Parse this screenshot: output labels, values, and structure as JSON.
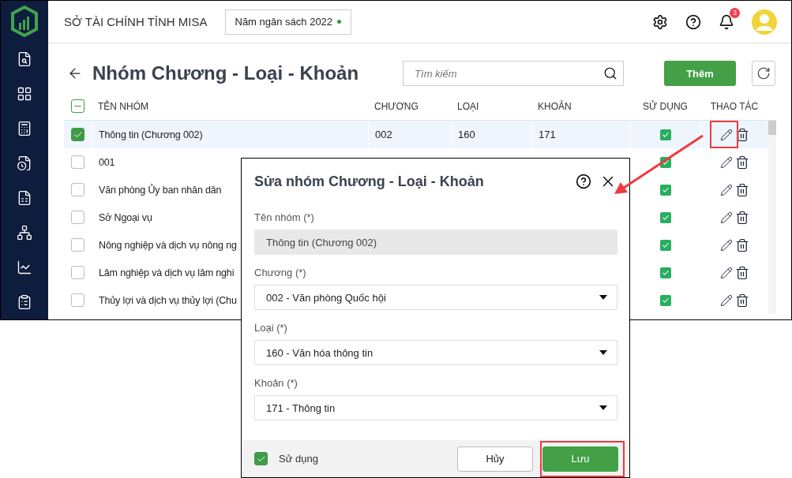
{
  "header": {
    "organization": "SỞ TÀI CHÍNH TỈNH MISA",
    "budget_year": "Năm ngân sách 2022",
    "notification_count": "3"
  },
  "page": {
    "title": "Nhóm Chương - Loại - Khoản",
    "search": {
      "placeholder": "Tìm kiếm"
    },
    "add_button": "Thêm"
  },
  "table": {
    "select_all": {
      "indeterminate": true
    },
    "columns": [
      "TÊN NHÓM",
      "CHƯƠNG",
      "LOẠI",
      "KHOẢN",
      "SỬ DỤNG",
      "THAO TÁC"
    ],
    "rows": [
      {
        "name": "Thông tin (Chương 002)",
        "chuong": "002",
        "loai": "160",
        "khoan": "171",
        "checked": true,
        "selected": true,
        "used": true
      },
      {
        "name": "001",
        "checked": false,
        "selected": false,
        "used": true
      },
      {
        "name": "Văn phòng Ủy ban nhân dân",
        "checked": false,
        "selected": false,
        "used": true
      },
      {
        "name": "Sở Ngoại vụ",
        "checked": false,
        "selected": false,
        "used": true
      },
      {
        "name": "Nông nghiệp và dịch vụ nông ng",
        "checked": false,
        "selected": false,
        "used": true
      },
      {
        "name": "Lâm nghiệp và dịch vụ lâm nghi",
        "checked": false,
        "selected": false,
        "used": true
      },
      {
        "name": "Thủy lợi và dịch vụ thủy lợi (Chu",
        "checked": false,
        "selected": false,
        "used": true
      }
    ]
  },
  "dialog": {
    "title": "Sửa nhóm Chương - Loại - Khoản",
    "fields": [
      {
        "kind": "text",
        "label": "Tên nhóm (*)",
        "value": "Thông tin (Chương 002)",
        "disabled": true
      },
      {
        "kind": "select",
        "label": "Chương (*)",
        "value": "002 - Văn phòng Quốc hội",
        "disabled": false
      },
      {
        "kind": "select",
        "label": "Loại (*)",
        "value": "160 - Văn hóa thông tin",
        "disabled": false
      },
      {
        "kind": "select",
        "label": "Khoản (*)",
        "value": "171 - Thông tin",
        "disabled": false
      }
    ],
    "used": {
      "label": "Sử dụng",
      "checked": true
    },
    "buttons": [
      {
        "kind": "secondary",
        "label": "Hủy"
      },
      {
        "kind": "primary",
        "label": "Lưu"
      }
    ]
  }
}
